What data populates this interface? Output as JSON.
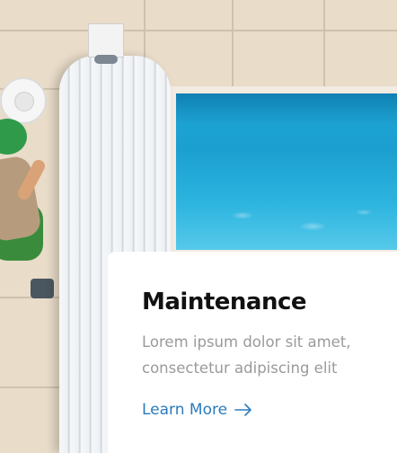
{
  "card": {
    "title": "Maintenance",
    "description": "Lorem ipsum dolor sit amet, consectetur adipiscing elit",
    "link_label": "Learn More",
    "link_icon": "arrow-right-icon"
  },
  "colors": {
    "link": "#2a7bbd",
    "title": "#111111",
    "description": "#9a9a9a",
    "card_bg": "#ffffff",
    "pool_water": "#1fa8d6"
  }
}
